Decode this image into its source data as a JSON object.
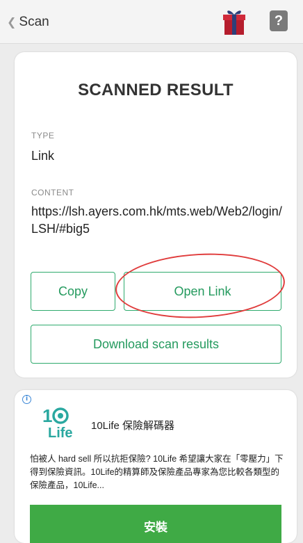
{
  "header": {
    "back_label": "Scan",
    "help_label": "?"
  },
  "result": {
    "title": "SCANNED RESULT",
    "type_label": "TYPE",
    "type_value": "Link",
    "content_label": "CONTENT",
    "content_value": "https://lsh.ayers.com.hk/mts.web/Web2/login/LSH/#big5",
    "copy_label": "Copy",
    "open_label": "Open Link",
    "download_label": "Download scan results"
  },
  "ad": {
    "info_label": "i",
    "title": "10Life 保險解碼器",
    "description": "怕被人 hard sell 所以抗拒保險? 10Life 希望讓大家在「零壓力」下得到保險資訊。10Life的精算師及保險產品專家為您比較各類型的保險產品，10Life...",
    "install_label": "安裝",
    "logo_text": "10 Life"
  },
  "colors": {
    "accent_green": "#2eaa6d",
    "install_green": "#3faa45",
    "annotation_red": "#e03c3c"
  }
}
